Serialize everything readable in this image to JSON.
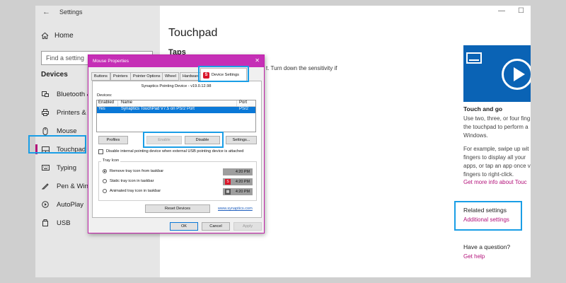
{
  "window": {
    "title": "Settings",
    "back_glyph": "←",
    "minimize": "—",
    "maximize": "☐"
  },
  "sidebar": {
    "home_label": "Home",
    "search_placeholder": "Find a setting",
    "section_label": "Devices",
    "items": [
      {
        "label": "Bluetooth & c",
        "icon": "bluetooth-icon"
      },
      {
        "label": "Printers & sca",
        "icon": "printer-icon"
      },
      {
        "label": "Mouse",
        "icon": "mouse-icon"
      },
      {
        "label": "Touchpad",
        "icon": "touchpad-icon",
        "active": true
      },
      {
        "label": "Typing",
        "icon": "keyboard-icon"
      },
      {
        "label": "Pen & Window",
        "icon": "pen-icon"
      },
      {
        "label": "AutoPlay",
        "icon": "autoplay-icon"
      },
      {
        "label": "USB",
        "icon": "usb-icon"
      }
    ]
  },
  "main": {
    "title": "Touchpad",
    "section": "Taps",
    "partial_text": "t. Turn down the sensitivity if"
  },
  "right_panel": {
    "video_title": "Touch and go",
    "para1": "Use two, three, or four fing\nthe touchpad to perform a\nWindows.",
    "para2": "For example, swipe up wit\nfingers to display all your\napps, or tap an app once v\nfingers to right-click.",
    "more_info_link": "Get more info about Touc",
    "related_heading": "Related settings",
    "related_link": "Additional settings",
    "question_heading": "Have a question?",
    "help_link": "Get help"
  },
  "dialog": {
    "title": "Mouse Properties",
    "close": "✕",
    "tabs": [
      "Buttons",
      "Pointers",
      "Pointer Options",
      "Wheel",
      "Hardware"
    ],
    "active_tab": "Device Settings",
    "device_header": "Synaptics Pointing Device - v19.0.12.98",
    "devices_label": "Devices:",
    "table_headers": {
      "enabled": "Enabled",
      "name": "Name",
      "port": "Port"
    },
    "table_row": {
      "enabled": "Yes",
      "name": "Synaptics TouchPad V7.5 on PS/2 Port",
      "port": "PS/2"
    },
    "buttons": {
      "profiles": "Profiles",
      "enable": "Enable",
      "disable": "Disable",
      "settings": "Settings...",
      "reset": "Reset Devices",
      "ok": "OK",
      "cancel": "Cancel",
      "apply": "Apply"
    },
    "disable_internal_label": "Disable internal pointing device when external USB pointing device is attached",
    "tray_group_title": "Tray Icon",
    "tray_options": [
      {
        "label": "Remove tray icon from taskbar",
        "selected": true,
        "time": "4:20 PM",
        "icon": ""
      },
      {
        "label": "Static tray icon in taskbar",
        "selected": false,
        "time": "4:20 PM",
        "icon": "synaptics-tray-icon"
      },
      {
        "label": "Animated tray icon in taskbar",
        "selected": false,
        "time": "4:20 PM",
        "icon": "animated-tray-icon"
      }
    ],
    "website_link": "www.synaptics.com"
  },
  "colors": {
    "accent": "#b3127a",
    "callout": "#1a9ee6",
    "dialog_title": "#c52fb6",
    "selection": "#0a78d7"
  }
}
